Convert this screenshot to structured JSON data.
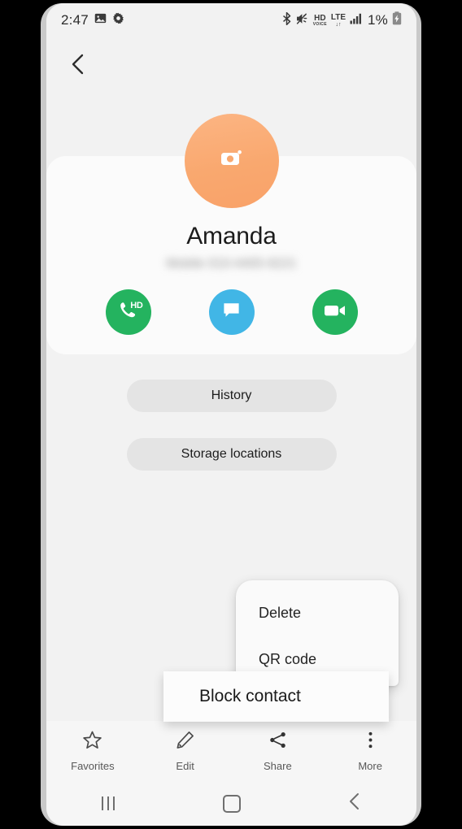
{
  "status_bar": {
    "time": "2:47",
    "battery_percent": "1%",
    "icons": {
      "photo": "image-icon",
      "settings": "gear-icon",
      "bluetooth": "bluetooth-icon",
      "mute": "volume-mute-icon",
      "hd_voice_top": "HD",
      "hd_voice_bottom": "VOICE",
      "lte_top": "LTE",
      "lte_bottom": "↓↑",
      "signal": "signal-bars-icon",
      "battery": "battery-charging-icon"
    }
  },
  "top_bar": {
    "back_icon": "chevron-left-icon"
  },
  "contact": {
    "avatar_icon": "camera-icon",
    "avatar_color": "#f9a86f",
    "name": "Amanda",
    "phone_number": "Mobile 010-4405-9221",
    "actions": [
      {
        "label": "Call",
        "icon": "phone-hd-icon",
        "badge": "HD",
        "color": "#24b35f"
      },
      {
        "label": "Message",
        "icon": "message-bubble-icon",
        "badge": "",
        "color": "#41b6e6"
      },
      {
        "label": "Video call",
        "icon": "video-camera-icon",
        "badge": "",
        "color": "#24b35f"
      }
    ]
  },
  "pills": {
    "history": "History",
    "storage": "Storage locations"
  },
  "popup_menu": {
    "items": [
      {
        "label": "Delete"
      },
      {
        "label": "QR code"
      }
    ]
  },
  "block_strip": {
    "label": "Block contact"
  },
  "bottom_toolbar": {
    "items": [
      {
        "label": "Favorites",
        "icon": "star-icon"
      },
      {
        "label": "Edit",
        "icon": "pencil-icon"
      },
      {
        "label": "Share",
        "icon": "share-icon"
      },
      {
        "label": "More",
        "icon": "more-vertical-icon"
      }
    ]
  },
  "nav_bar": {
    "items": [
      {
        "name": "recents",
        "icon": "recents-icon"
      },
      {
        "name": "home",
        "icon": "home-square-icon"
      },
      {
        "name": "back",
        "icon": "chevron-left-icon"
      }
    ]
  }
}
